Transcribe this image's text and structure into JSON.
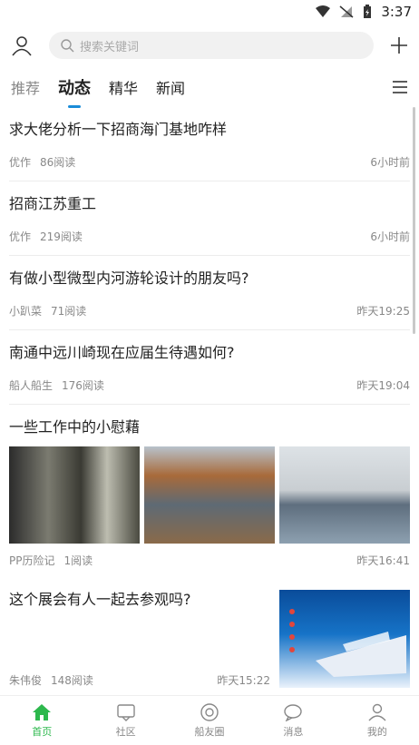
{
  "status": {
    "time": "3:37"
  },
  "search": {
    "placeholder": "搜索关键词"
  },
  "tabs": [
    {
      "label": "推荐"
    },
    {
      "label": "动态"
    },
    {
      "label": "精华"
    },
    {
      "label": "新闻"
    }
  ],
  "feed": [
    {
      "title": "求大佬分析一下招商海门基地咋样",
      "author": "优作",
      "reads": "86阅读",
      "time": "6小时前"
    },
    {
      "title": "招商江苏重工",
      "author": "优作",
      "reads": "219阅读",
      "time": "6小时前"
    },
    {
      "title": "有做小型微型内河游轮设计的朋友吗?",
      "author": "小趴菜",
      "reads": "71阅读",
      "time": "昨天19:25"
    },
    {
      "title": "南通中远川崎现在应届生待遇如何?",
      "author": "船人船生",
      "reads": "176阅读",
      "time": "昨天19:04"
    },
    {
      "title": "一些工作中的小慰藉",
      "author": "PP历险记",
      "reads": "1阅读",
      "time": "昨天16:41"
    },
    {
      "title": "这个展会有人一起去参观吗?",
      "author": "朱伟俊",
      "reads": "148阅读",
      "time": "昨天15:22"
    }
  ],
  "bottom_nav": [
    {
      "label": "首页",
      "icon": "home-icon"
    },
    {
      "label": "社区",
      "icon": "community-icon"
    },
    {
      "label": "船友圈",
      "icon": "circle-icon"
    },
    {
      "label": "消息",
      "icon": "message-icon"
    },
    {
      "label": "我的",
      "icon": "profile-icon"
    }
  ],
  "colors": {
    "accent_green": "#2db84d",
    "tab_indicator": "#1a8cd8"
  }
}
